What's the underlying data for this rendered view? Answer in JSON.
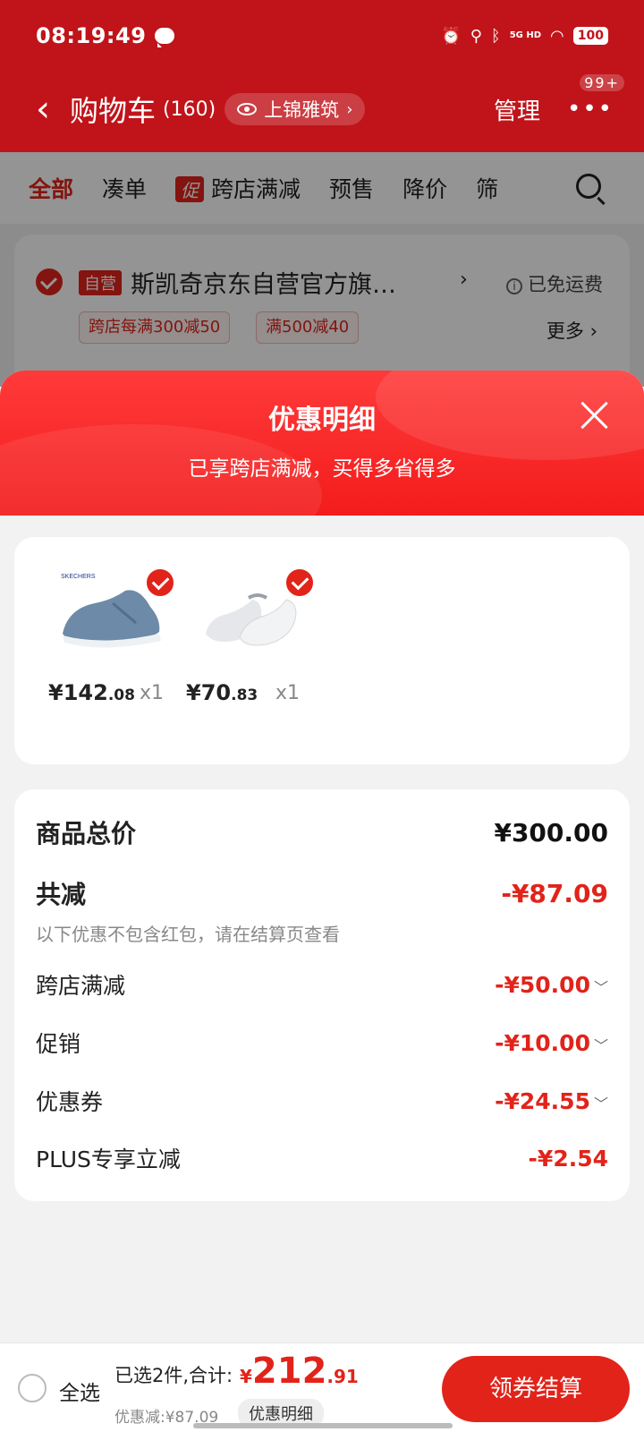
{
  "status": {
    "time": "08:19:49",
    "network": "5G HD",
    "battery": "100"
  },
  "header": {
    "title": "购物车",
    "count": "(160)",
    "location": "上锦雅筑",
    "manage": "管理",
    "more_badge": "99+"
  },
  "tabs": {
    "all": "全部",
    "bundle": "凑单",
    "promo_badge": "促",
    "cross_store": "跨店满减",
    "presale": "预售",
    "price_drop": "降价",
    "filter": "筛"
  },
  "store": {
    "self_badge": "自营",
    "name": "斯凯奇京东自营官方旗…",
    "shipping": "已免运费",
    "tags": [
      "跨店每满300减50",
      "满500减40"
    ],
    "more": "更多"
  },
  "sheet": {
    "title": "优惠明细",
    "subtitle": "已享跨店满减，买得多省得多"
  },
  "goods": [
    {
      "yen": "¥",
      "int": "142",
      "dec": ".08",
      "qty": "x1"
    },
    {
      "yen": "¥",
      "int": "70",
      "dec": ".83",
      "qty": "x1"
    }
  ],
  "summary": {
    "total_label": "商品总价",
    "total_value": "¥300.00",
    "cut_label": "共减",
    "cut_value": "-¥87.09",
    "note": "以下优惠不包含红包，请在结算页查看",
    "rows": [
      {
        "label": "跨店满减",
        "value": "-¥50.00"
      },
      {
        "label": "促销",
        "value": "-¥10.00"
      },
      {
        "label": "优惠券",
        "value": "-¥24.55"
      },
      {
        "label": "PLUS专享立减",
        "value": "-¥2.54"
      }
    ]
  },
  "bottom": {
    "select_all": "全选",
    "picked": "已选2件,合计:",
    "amount_yen": "¥",
    "amount_int": "212",
    "amount_dec": ".91",
    "saved": "优惠减:¥87.09",
    "detail": "优惠明细",
    "checkout": "领券结算"
  },
  "colors": {
    "brand_red": "#e2231a",
    "header_red": "#c0141a"
  }
}
